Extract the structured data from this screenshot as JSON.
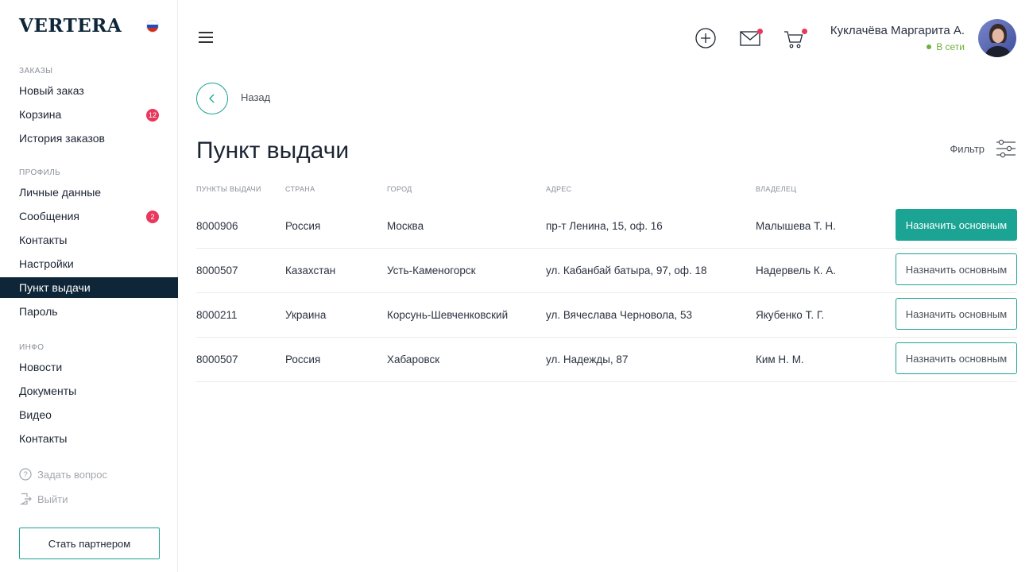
{
  "sidebar": {
    "logo": "VERTERA",
    "sections": [
      {
        "label": "ЗАКАЗЫ",
        "items": [
          {
            "label": "Новый заказ"
          },
          {
            "label": "Корзина",
            "badge": "12"
          },
          {
            "label": "История заказов"
          }
        ]
      },
      {
        "label": "ПРОФИЛЬ",
        "items": [
          {
            "label": "Личные данные"
          },
          {
            "label": "Сообщения",
            "badge": "2"
          },
          {
            "label": "Контакты"
          },
          {
            "label": "Настройки"
          },
          {
            "label": "Пункт выдачи",
            "active": true
          },
          {
            "label": "Пароль"
          }
        ]
      },
      {
        "label": "ИНФО",
        "items": [
          {
            "label": "Новости"
          },
          {
            "label": "Документы"
          },
          {
            "label": "Видео"
          },
          {
            "label": "Контакты"
          }
        ]
      }
    ],
    "ask_question": "Задать вопрос",
    "logout": "Выйти",
    "partner_button": "Стать партнером"
  },
  "header": {
    "user_name": "Куклачёва Маргарита А.",
    "user_status": "В сети",
    "icons": [
      "menu-icon",
      "add-circle-icon",
      "mail-icon",
      "cart-icon"
    ]
  },
  "back_label": "Назад",
  "page_title": "Пункт выдачи",
  "filter_label": "Фильтр",
  "table": {
    "headers": [
      "ПУНКТЫ ВЫДАЧИ",
      "СТРАНА",
      "ГОРОД",
      "АДРЕС",
      "ВЛАДЕЛЕЦ"
    ],
    "rows": [
      {
        "id": "8000906",
        "country": "Россия",
        "city": "Москва",
        "address": "пр-т Ленина, 15, оф. 16",
        "owner": "Малышева Т. Н.",
        "button": "Назначить основным",
        "primary": true
      },
      {
        "id": "8000507",
        "country": "Казахстан",
        "city": "Усть-Каменогорск",
        "address": "ул. Кабанбай батыра, 97, оф. 18",
        "owner": "Надервель К. А.",
        "button": "Назначить основным",
        "primary": false
      },
      {
        "id": "8000211",
        "country": "Украина",
        "city": "Корсунь-Шевченковский",
        "address": "ул. Вячеслава Черновола, 53",
        "owner": "Якубенко Т. Г.",
        "button": "Назначить основным",
        "primary": false
      },
      {
        "id": "8000507",
        "country": "Россия",
        "city": "Хабаровск",
        "address": "ул. Надежды, 87",
        "owner": "Ким Н. М.",
        "button": "Назначить основным",
        "primary": false
      }
    ]
  },
  "colors": {
    "accent": "#1ba394",
    "dark": "#0e2638",
    "badge": "#e8385c",
    "online": "#6fb03a"
  }
}
